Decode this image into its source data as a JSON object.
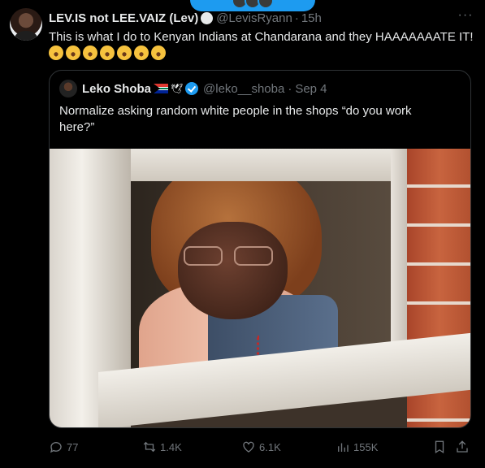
{
  "tweet": {
    "author_name": "LEV.IS not LEE.VAIZ (Lev)",
    "author_handle": "@LevisRyann",
    "time": "15h",
    "separator": "·",
    "more_label": "···",
    "text": "This is what I do to Kenyan Indians at Chandarana and they HAAAAAAATE IT! ",
    "emoji_count": 7,
    "emoji_name": "face-with-tears-of-joy"
  },
  "quote": {
    "author_name": "Leko Shoba",
    "author_handle": "@leko__shoba",
    "date": "Sep 4",
    "separator": "·",
    "text": "Normalize asking random white people in the shops “do you work here?”",
    "flag": "south-africa-flag",
    "bird": "twitter-bird-icon",
    "verified_color": "#1d9bf0"
  },
  "actions": {
    "replies": "77",
    "retweets": "1.4K",
    "likes": "6.1K",
    "views": "155K"
  },
  "colors": {
    "background": "#000000",
    "text": "#e7e9ea",
    "muted": "#71767b",
    "border": "#2f3336",
    "accent": "#1d9bf0"
  }
}
